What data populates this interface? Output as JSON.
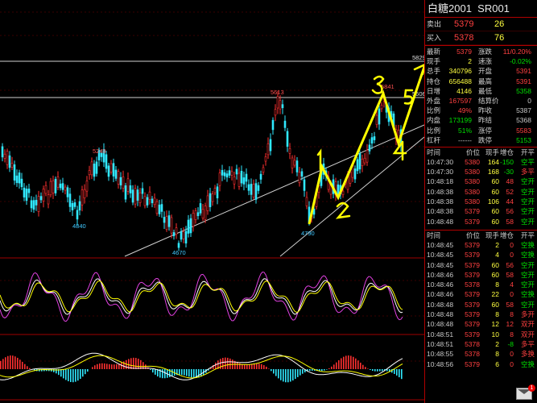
{
  "instrument": {
    "name": "白糖2001",
    "code": "SR001"
  },
  "quote": {
    "ask": {
      "label": "卖出",
      "price": "5379",
      "volume": "26"
    },
    "bid": {
      "label": "买入",
      "price": "5378",
      "volume": "76"
    }
  },
  "stats": [
    {
      "k1": "最新",
      "v1": "5379",
      "c1": "#ff4040",
      "k2": "涨跌",
      "v2": "11/0.20%",
      "c2": "#ff4040"
    },
    {
      "k1": "现手",
      "v1": "2",
      "c1": "#ffff40",
      "k2": "速涨",
      "v2": "-0.02%",
      "c2": "#00e000"
    },
    {
      "k1": "总手",
      "v1": "340796",
      "c1": "#ffff40",
      "k2": "开盘",
      "v2": "5391",
      "c2": "#ff4040"
    },
    {
      "k1": "持仓",
      "v1": "656488",
      "c1": "#ffff40",
      "k2": "最高",
      "v2": "5391",
      "c2": "#ff4040"
    },
    {
      "k1": "日增",
      "v1": "4146",
      "c1": "#ffff40",
      "k2": "最低",
      "v2": "5358",
      "c2": "#00e000"
    },
    {
      "k1": "外盘",
      "v1": "167597",
      "c1": "#ff4040",
      "k2": "结算价",
      "v2": "0",
      "c2": "#c8c8c8"
    },
    {
      "k1": "比例",
      "v1": "49%",
      "c1": "#ff4040",
      "k2": "昨收",
      "v2": "5387",
      "c2": "#c8c8c8"
    },
    {
      "k1": "内盘",
      "v1": "173199",
      "c1": "#00e000",
      "k2": "昨结",
      "v2": "5368",
      "c2": "#c8c8c8"
    },
    {
      "k1": "比例",
      "v1": "51%",
      "c1": "#00e000",
      "k2": "涨停",
      "v2": "5583",
      "c2": "#ff4040"
    },
    {
      "k1": "杠杆",
      "v1": "------",
      "c1": "#c8c8c8",
      "k2": "跌停",
      "v2": "5153",
      "c2": "#00e000"
    }
  ],
  "ticks_header": [
    "时间",
    "价位",
    "现手",
    "增仓",
    "开平"
  ],
  "ticks1": [
    [
      "10:47:30",
      "5380",
      "164",
      "-150",
      "空平"
    ],
    [
      "10:47:30",
      "5380",
      "168",
      "-30",
      "多平"
    ],
    [
      "10:48:18",
      "5380",
      "60",
      "48",
      "空开"
    ],
    [
      "10:48:38",
      "5380",
      "60",
      "52",
      "空开"
    ],
    [
      "10:48:38",
      "5380",
      "106",
      "44",
      "空开"
    ],
    [
      "10:48:38",
      "5379",
      "60",
      "56",
      "空开"
    ],
    [
      "10:48:48",
      "5379",
      "60",
      "58",
      "空开"
    ]
  ],
  "ticks2": [
    [
      "10:48:45",
      "5379",
      "2",
      "0",
      "空换"
    ],
    [
      "10:48:45",
      "5379",
      "4",
      "0",
      "空换"
    ],
    [
      "10:48:45",
      "5379",
      "60",
      "56",
      "空开"
    ],
    [
      "10:48:46",
      "5379",
      "60",
      "58",
      "空开"
    ],
    [
      "10:48:46",
      "5378",
      "8",
      "4",
      "空开"
    ],
    [
      "10:48:46",
      "5379",
      "22",
      "0",
      "空换"
    ],
    [
      "10:48:48",
      "5379",
      "60",
      "58",
      "空开"
    ],
    [
      "10:48:48",
      "5379",
      "8",
      "8",
      "多开"
    ],
    [
      "10:48:48",
      "5379",
      "12",
      "12",
      "双开"
    ],
    [
      "10:48:51",
      "5379",
      "10",
      "8",
      "双开"
    ],
    [
      "10:48:51",
      "5378",
      "2",
      "-8",
      "多平"
    ],
    [
      "10:48:55",
      "5378",
      "8",
      "0",
      "多换"
    ],
    [
      "10:48:56",
      "5379",
      "6",
      "0",
      "空换"
    ]
  ],
  "chart_data": {
    "type": "candlestick",
    "price_labels": [
      {
        "text": "5829"
      },
      {
        "text": "5613"
      },
      {
        "text": "5249"
      },
      {
        "text": "4840"
      },
      {
        "text": "4670"
      },
      {
        "text": "4790"
      },
      {
        "text": "5841"
      },
      {
        "text": "5606"
      }
    ],
    "annotations": [
      "1",
      "2",
      "3",
      "4",
      "5"
    ],
    "mail_badge": "1"
  }
}
